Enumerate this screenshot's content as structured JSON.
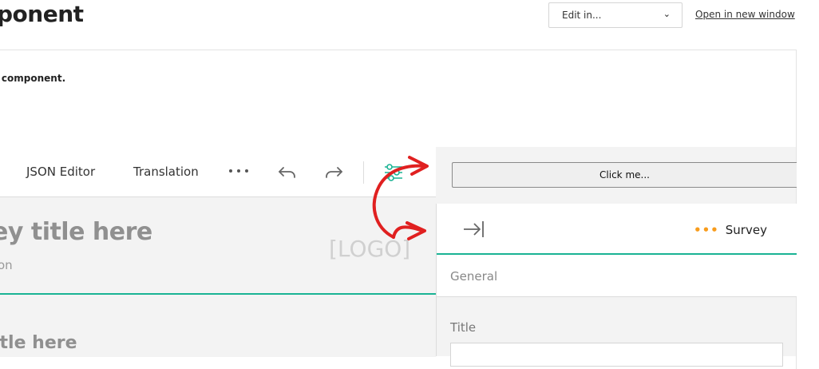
{
  "header": {
    "title": "ponent",
    "edit_select": {
      "value": "Edit in...",
      "chevron": "⌄"
    },
    "open_link": "Open in new window"
  },
  "intro_text": "t component.",
  "toolbar": {
    "tabs": [
      "JSON Editor",
      "Translation"
    ],
    "icons": [
      "more-dots-icon",
      "undo-icon",
      "redo-icon",
      "settings-sliders-icon"
    ]
  },
  "survey": {
    "title": "ey title here",
    "description": "on",
    "logo": "[LOGO]",
    "page_title": "itle here"
  },
  "right": {
    "button_label": "Click me..."
  },
  "property_panel": {
    "tab_label": "Survey",
    "tab_dots": "•••",
    "section": "General",
    "field_label": "Title"
  },
  "colors": {
    "accent": "#1ab394",
    "annotation": "#e02020",
    "dots": "#f89c1c"
  }
}
